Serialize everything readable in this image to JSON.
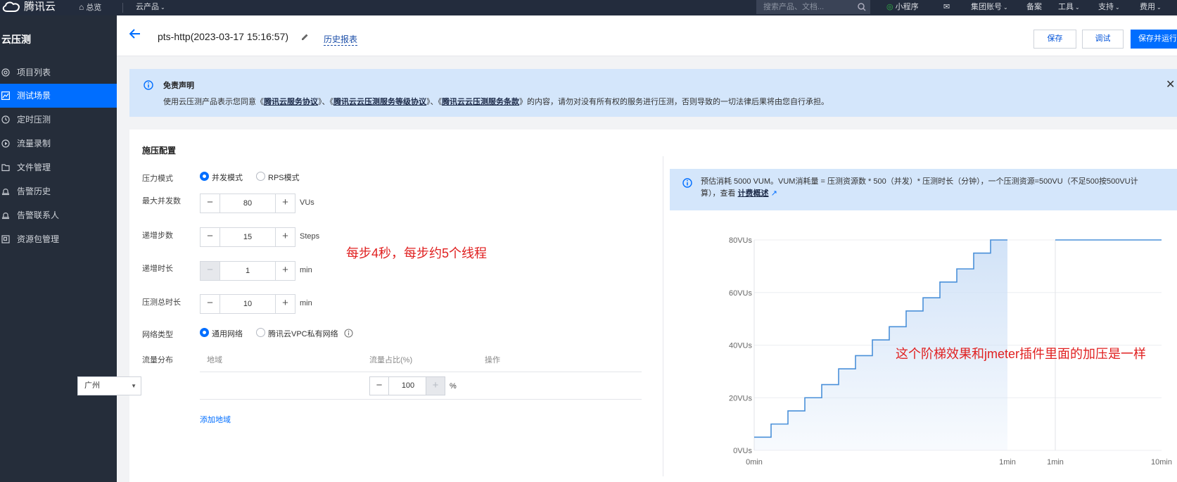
{
  "topbar": {
    "brand": "腾讯云",
    "overview": "总览",
    "products": "云产品",
    "search_placeholder": "搜索产品、文档...",
    "miniprogram": "小程序",
    "account": "集团账号",
    "beian": "备案",
    "tools": "工具",
    "support": "支持",
    "billing": "费用"
  },
  "sidebar": {
    "title": "云压测",
    "items": [
      {
        "label": "项目列表",
        "icon": "gear-icon"
      },
      {
        "label": "测试场景",
        "icon": "chart-icon"
      },
      {
        "label": "定时压测",
        "icon": "clock-icon"
      },
      {
        "label": "流量录制",
        "icon": "play-icon"
      },
      {
        "label": "文件管理",
        "icon": "folder-icon"
      },
      {
        "label": "告警历史",
        "icon": "bell-icon"
      },
      {
        "label": "告警联系人",
        "icon": "contact-icon"
      },
      {
        "label": "资源包管理",
        "icon": "package-icon"
      }
    ],
    "active_index": 1
  },
  "header": {
    "title": "pts-http(2023-03-17 15:16:57)",
    "history": "历史报表",
    "save": "保存",
    "debug": "调试",
    "save_run": "保存并运行"
  },
  "notice": {
    "title": "免责声明",
    "text_pre": "使用云压测产品表示您同意《",
    "link1": "腾讯云服务协议",
    "sep1": "》、《",
    "link2": "腾讯云云压测服务等级协议",
    "sep2": "》、《",
    "link3": "腾讯云云压测服务条款",
    "text_post": "》的内容，请勿对没有所有权的服务进行压测，否则导致的一切法律后果将由您自行承担。"
  },
  "config": {
    "title": "施压配置",
    "pressure_mode_label": "压力模式",
    "mode_concurrent": "并发模式",
    "mode_rps": "RPS模式",
    "max_concurrency_label": "最大并发数",
    "max_concurrency_value": "80",
    "max_concurrency_unit": "VUs",
    "ramp_steps_label": "递增步数",
    "ramp_steps_value": "15",
    "ramp_steps_unit": "Steps",
    "ramp_time_label": "递增时长",
    "ramp_time_value": "1",
    "ramp_time_unit": "min",
    "total_time_label": "压测总时长",
    "total_time_value": "10",
    "total_time_unit": "min",
    "network_label": "网络类型",
    "network_general": "通用网络",
    "network_vpc": "腾讯云VPC私有网络",
    "traffic_label": "流量分布",
    "col_region": "地域",
    "col_ratio": "流量占比(%)",
    "col_action": "操作",
    "region_value": "广州",
    "ratio_value": "100",
    "ratio_unit": "%",
    "add_region": "添加地域"
  },
  "annotations": {
    "note1": "每步4秒，每步约5个线程",
    "note2": "这个阶梯效果和jmeter插件里面的加压是一样"
  },
  "estimate": {
    "text_pre": "预估消耗 5000 VUM。VUM消耗量 = 压测资源数 * 500（并发）* 压测时长（分钟），一个压测资源=500VU（不足500按500VU计算），查看 ",
    "link": "计费概述"
  },
  "chart_data": {
    "type": "line",
    "y_tick_labels": [
      "0VUs",
      "20VUs",
      "40VUs",
      "60VUs",
      "80VUs"
    ],
    "ylim": [
      0,
      80
    ],
    "x_tick_labels": [
      "0min",
      "1min",
      "1min",
      "10min"
    ],
    "ramp": {
      "x_start": 0,
      "x_end": 1,
      "steps": 15,
      "values": [
        5,
        10,
        15,
        20,
        25,
        31,
        36,
        42,
        47,
        53,
        58,
        64,
        69,
        75,
        80
      ]
    },
    "hold": {
      "x_start": 1,
      "x_end": 10,
      "value": 80
    },
    "line_color": "#4a90d9",
    "fill_color": "#cfe1f7"
  }
}
